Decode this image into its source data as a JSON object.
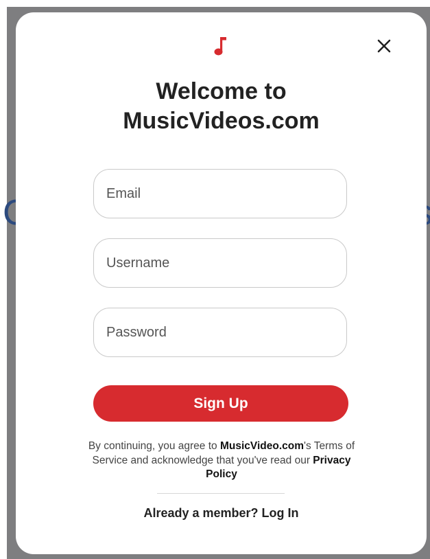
{
  "background": {
    "left_fragment": "C",
    "right_fragment": "s"
  },
  "modal": {
    "logo_icon": "music-note-icon",
    "close_icon": "close-icon",
    "title_line1": "Welcome to",
    "title_line2": "MusicVideos.com",
    "fields": {
      "email_placeholder": "Email",
      "username_placeholder": "Username",
      "password_placeholder": "Password"
    },
    "signup_label": "Sign Up",
    "legal": {
      "prefix": "By continuing, you agree to ",
      "brand": "MusicVideo.com",
      "middle": "'s Terms of Service and acknowledge that you've read our ",
      "privacy_link": "Privacy Policy"
    },
    "login_prompt": "Already a member? Log In"
  },
  "colors": {
    "accent": "#d72b2f",
    "backdrop": "#7e7e80"
  }
}
